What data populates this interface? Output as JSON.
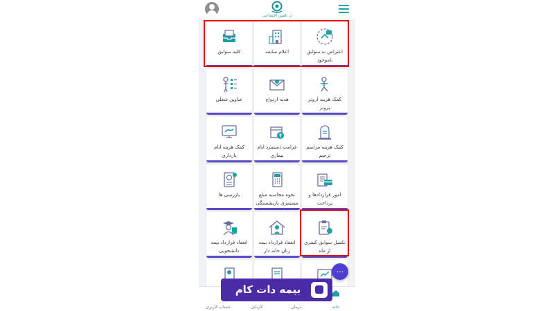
{
  "app": {
    "logo_caption": "سازمان تامین اجتماعی"
  },
  "colors": {
    "accent": "#1aa1a6",
    "tile_border": "#5a49c6",
    "highlight": "#e3000f",
    "fab": "#4f3fd0",
    "watermark_bg": "#4b2aa5"
  },
  "tiles": [
    {
      "label": "اعتراض به سوابق ناموجود",
      "icon": "objection-icon"
    },
    {
      "label": "اعلام سابقه",
      "icon": "building-icon"
    },
    {
      "label": "کلیه سوابق",
      "icon": "archive-tray-icon"
    },
    {
      "label": "کمک هزینه اروتز پروتز",
      "icon": "prosthesis-icon"
    },
    {
      "label": "هدیه ازدواج",
      "icon": "envelope-icon"
    },
    {
      "label": "عناوین شغلی",
      "icon": "worker-checklist-icon"
    },
    {
      "label": "کمک هزینه مراسم ترحیم",
      "icon": "tombstone-icon"
    },
    {
      "label": "غرامت دستمزد ایام بیماری",
      "icon": "calendar-wage-icon"
    },
    {
      "label": "کمک هزینه ایام بارداری",
      "icon": "monitor-hand-icon"
    },
    {
      "label": "امور قراردادها و پرداخت",
      "icon": "contract-card-icon"
    },
    {
      "label": "نحوه محاسبه مبلغ مستمری بازنشستگی",
      "icon": "calculator-icon"
    },
    {
      "label": "بازرسی ها",
      "icon": "passport-icon"
    },
    {
      "label": "تکمیل سوابق کسری از ماه",
      "icon": "clipboard-user-icon"
    },
    {
      "label": "انعقاد قرارداد بیمه زنان خانه دار",
      "icon": "house-woman-icon"
    },
    {
      "label": "انعقاد قرارداد بیمه دانشجویی",
      "icon": "student-icon"
    }
  ],
  "fab": {
    "label": "..."
  },
  "bottom_nav": [
    {
      "label": "خانه",
      "icon": "home-icon"
    },
    {
      "label": "درمان",
      "icon": "treatment-icon"
    },
    {
      "label": "کارتابل",
      "icon": "inbox-icon"
    },
    {
      "label": "حساب کاربری",
      "icon": "user-icon"
    }
  ],
  "watermark": {
    "text": "بیمه دات کام"
  }
}
